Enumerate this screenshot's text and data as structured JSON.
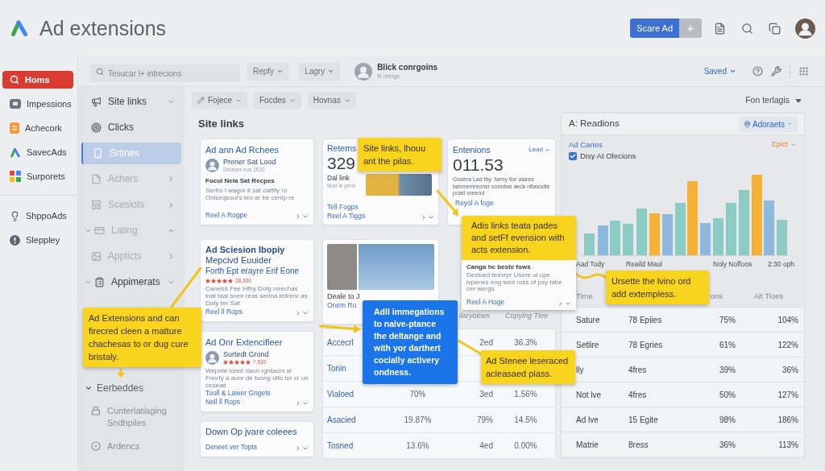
{
  "header": {
    "title": "Ad extensions",
    "primary_button": "Scare Ad",
    "add_button": "+"
  },
  "sidebar": {
    "groups": [
      [
        {
          "label": "Homs",
          "selected": true
        },
        {
          "label": "Impessions",
          "selected": false
        },
        {
          "label": "Achecork",
          "selected": false
        },
        {
          "label": "SavecAds",
          "selected": false
        },
        {
          "label": "Surporets",
          "selected": false
        }
      ],
      [
        {
          "label": "ShppoAds",
          "selected": false
        },
        {
          "label": "Sleppley",
          "selected": false
        }
      ]
    ]
  },
  "toolbar": {
    "search": {
      "placeholder": "Tesucar l+ intrecions"
    },
    "dropdowns": [
      "Repfy",
      "Lagry"
    ],
    "account": {
      "name": "Blick conrgoins",
      "detail": "R reings"
    },
    "saved_menu": "Saved"
  },
  "subnav": {
    "items": [
      {
        "kind": "dropdown",
        "label": "Site links",
        "selected": false,
        "disabled": false
      },
      {
        "kind": "link",
        "label": "Clicks",
        "selected": false,
        "disabled": false
      },
      {
        "kind": "link",
        "label": "Srtines",
        "selected": true,
        "disabled": false
      },
      {
        "kind": "submenu",
        "label": "Achers",
        "selected": false,
        "disabled": true
      },
      {
        "kind": "submenu",
        "label": "Scesiots",
        "selected": false,
        "disabled": true
      },
      {
        "kind": "group",
        "label": "Lating",
        "expanded": true,
        "selected": false,
        "disabled": true
      },
      {
        "kind": "submenu",
        "label": "Applicts",
        "selected": false,
        "disabled": true
      },
      {
        "kind": "group",
        "label": "Appimerats",
        "expanded": false,
        "selected": false,
        "disabled": false
      }
    ],
    "sections": [
      {
        "label": "Eerbeddes",
        "expanded": true,
        "children": [
          {
            "label": "Cunterlatiaging Sndhpiles",
            "selected": false
          },
          {
            "label": "Ardencs",
            "selected": false
          }
        ]
      }
    ]
  },
  "filters": [
    "Fojece",
    "Focdes",
    "Hovnas"
  ],
  "section_title": "Site links",
  "cards": [
    {
      "kind": "profile",
      "title": "Ad ann Ad Rchees",
      "author": "Prener Sat Lood",
      "meta": "Droeser rius 2020",
      "heading": "Focul Nela Sat Recpes",
      "body": "Serfro l wagor it sat catfify ro Oniseqsoul's teu ar be cemp re",
      "links": [
        "Reel A Rogpe"
      ]
    },
    {
      "kind": "metric",
      "title": "Retems",
      "value": "329",
      "label": "Dal link",
      "sublabel": "Mod le yens",
      "links": [
        "Tell Fogps",
        "Reel A Tiggs"
      ]
    },
    {
      "kind": "stat",
      "title": "Entenions",
      "menu": "Lead",
      "value": "011.53",
      "body": "Gusera Lad thy. Iwrny tlor aiares tamrremreonsr oonnlws aeck nflasodte poarl oreeod",
      "links": [
        "Reyol A foge"
      ]
    },
    {
      "kind": "listing",
      "title": "Ad Sciesion Ibopiy",
      "subtitle": "Mepcivd Euuider",
      "tagline": "Forth Ept erayre Erif Eone",
      "stars": 5,
      "rating_count": "28,300",
      "body": "Canetnt Fee Hfhy Dotg mrechas inat taal sneir reas serlna teilrenr as Dafy brr Sat",
      "links": [
        "Reel ll Rops"
      ]
    },
    {
      "kind": "image",
      "caption": "Deale to J",
      "links": [
        "Onem Ro"
      ]
    },
    {
      "kind": "profile",
      "title": "Ad Onr Extencifleer",
      "author": "Surtedt Grond",
      "stars": 5,
      "rating_count": "7,530",
      "body": "Wepnte lonnt rlaun rgntacrn sr Fnnrfy a aunr de tuong ulfo tor cr un cesead",
      "links": [
        "Tooll & Lawer Gngets",
        "Nell ll Rops"
      ]
    },
    {
      "kind": "compact",
      "title": "Down Op jvare coleees",
      "links": [
        "Deneet ver Topts"
      ]
    }
  ],
  "table": {
    "header": {
      "column_3": "ilaryoines",
      "column_4": "Copying Tiee"
    },
    "rows": [
      {
        "column_1": "Accecrl",
        "column_3": "2ed",
        "column_4": "36.3%"
      },
      {
        "column_1": "Tonin"
      },
      {
        "column_1": "Vialoed",
        "column_2": "70%",
        "column_3": "3ed",
        "column_4": "1.56%"
      },
      {
        "column_1": "Asacied",
        "column_2": "19.87%",
        "column_3": "79%",
        "column_4": "14.5%"
      },
      {
        "column_1": "Tosned",
        "column_2": "13.6%",
        "column_3": "4ed",
        "column_4": "0.00%"
      }
    ]
  },
  "report": {
    "sort_menu": "Fon terlagis",
    "title": "A: Readions",
    "filter_button": "Adoraets",
    "series_link": "Ad Caries",
    "export_menu": "Epict",
    "checkbox": {
      "label": "Disy At Olecions",
      "checked": true
    },
    "axis_labels": [
      "Aad Tody",
      "Reaild Maul",
      "Noly Nolfoos",
      "2:30 oph"
    ],
    "table": {
      "header": {
        "column_1": "Time",
        "column_3": "ons",
        "column_4": "Alt Tioes"
      },
      "rows": [
        {
          "column_1": "Sature",
          "column_2": "78 Epiies",
          "column_3": "75%",
          "column_4": "104%"
        },
        {
          "column_1": "Setlire",
          "column_2": "78 Egries",
          "column_3": "61%",
          "column_4": "122%"
        },
        {
          "column_1": "lly",
          "column_2": "4fres",
          "column_3": "39%",
          "column_4": "36%"
        },
        {
          "column_1": "Not lve",
          "column_2": "4fres",
          "column_3": "50%",
          "column_4": "127%"
        },
        {
          "column_1": "Ad lve",
          "column_2": "15 Egite",
          "column_3": "98%",
          "column_4": "186%"
        },
        {
          "column_1": "Matrie",
          "column_2": "8ress",
          "column_3": "36%",
          "column_4": "113%"
        }
      ]
    }
  },
  "callouts": [
    {
      "kind": "note",
      "text": "Site links, lhouu ant the pilas."
    },
    {
      "kind": "card",
      "text": "Adis links teata pades and setFf evension with acts extension.",
      "heading": "Canga hc beste fows",
      "body": "Deslued teevrpr Usere ul upe ivpenes eng wed ross of psy tabe cer wergs",
      "link": "Reel A Hoge"
    },
    {
      "kind": "note",
      "text": "Ursette the lvino ord add extempless."
    },
    {
      "kind": "note",
      "text": "Ad Extensions and can firecred cleen a matture chachesas to or dug cure bristaly."
    },
    {
      "kind": "tip",
      "text": "Adll immegations to naive-ptance the deltange and with yor darthert cocially activery ondness."
    },
    {
      "kind": "note",
      "text": "Ad Stenee leseraced acleasaed plass."
    }
  ]
}
